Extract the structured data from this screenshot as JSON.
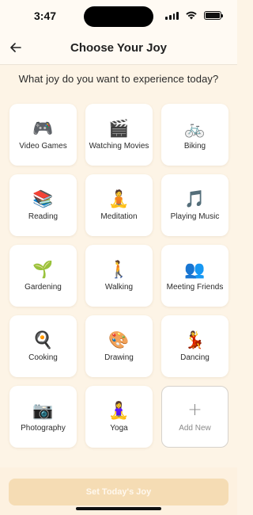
{
  "status_bar": {
    "time": "3:47"
  },
  "header": {
    "title": "Choose Your Joy"
  },
  "question": "What joy do you want to experience today?",
  "activities": [
    {
      "icon": "🎮",
      "icon_name": "game-controller-icon",
      "label": "Video Games"
    },
    {
      "icon": "🎬",
      "icon_name": "clapper-board-icon",
      "label": "Watching Movies"
    },
    {
      "icon": "🚲",
      "icon_name": "bicycle-icon",
      "label": "Biking"
    },
    {
      "icon": "📚",
      "icon_name": "books-icon",
      "label": "Reading"
    },
    {
      "icon": "🧘",
      "icon_name": "meditation-icon",
      "label": "Meditation"
    },
    {
      "icon": "🎵",
      "icon_name": "music-note-icon",
      "label": "Playing Music"
    },
    {
      "icon": "🌱",
      "icon_name": "seedling-icon",
      "label": "Gardening"
    },
    {
      "icon": "🚶",
      "icon_name": "walking-person-icon",
      "label": "Walking"
    },
    {
      "icon": "👥",
      "icon_name": "people-icon",
      "label": "Meeting Friends"
    },
    {
      "icon": "🍳",
      "icon_name": "frying-pan-icon",
      "label": "Cooking"
    },
    {
      "icon": "🎨",
      "icon_name": "palette-icon",
      "label": "Drawing"
    },
    {
      "icon": "💃",
      "icon_name": "dancer-icon",
      "label": "Dancing"
    },
    {
      "icon": "📷",
      "icon_name": "camera-icon",
      "label": "Photography"
    },
    {
      "icon": "🧘‍♀️",
      "icon_name": "yoga-icon",
      "label": "Yoga"
    }
  ],
  "add_new": {
    "icon": "+",
    "label": "Add New"
  },
  "cta": {
    "label": "Set Today's Joy"
  },
  "colors": {
    "background": "#fdf4e6",
    "card": "#ffffff",
    "cta_disabled": "#f5dcb4"
  }
}
